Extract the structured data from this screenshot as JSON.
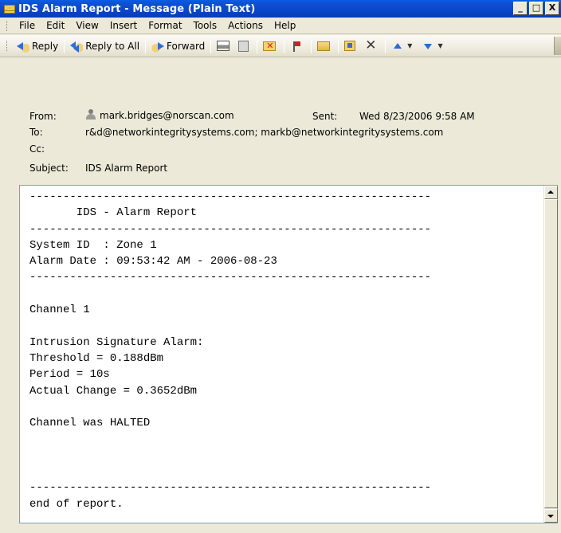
{
  "window": {
    "title": "IDS Alarm Report - Message (Plain Text)",
    "minimize": "_",
    "maximize": "□",
    "close": "X"
  },
  "menu": [
    "File",
    "Edit",
    "View",
    "Insert",
    "Format",
    "Tools",
    "Actions",
    "Help"
  ],
  "toolbar": {
    "reply": "Reply",
    "reply_all": "Reply to All",
    "forward": "Forward",
    "icons": [
      "reply-icon",
      "reply-all-icon",
      "forward-icon",
      "print-icon",
      "copy-icon",
      "move-to-folder-icon",
      "flag-icon",
      "folder-icon",
      "address-book-icon",
      "delete-icon",
      "previous-item-icon",
      "next-item-icon"
    ]
  },
  "header": {
    "from_label": "From:",
    "from_value": "mark.bridges@norscan.com",
    "sent_label": "Sent:",
    "sent_value": "Wed 8/23/2006 9:58 AM",
    "to_label": "To:",
    "to_value": "r&d@networkintegritysystems.com; markb@networkintegritysystems.com",
    "cc_label": "Cc:",
    "cc_value": "",
    "subject_label": "Subject:",
    "subject_value": "IDS Alarm Report"
  },
  "message": {
    "lines": [
      "------------------------------------------------------------",
      "       IDS - Alarm Report",
      "------------------------------------------------------------",
      "System ID  : Zone 1",
      "Alarm Date : 09:53:42 AM - 2006-08-23",
      "------------------------------------------------------------",
      "",
      "Channel 1",
      "",
      "Intrusion Signature Alarm:",
      "Threshold = 0.188dBm",
      "Period = 10s",
      "Actual Change = 0.3652dBm",
      "",
      "Channel was HALTED",
      "",
      "",
      "",
      "------------------------------------------------------------",
      "end of report."
    ]
  },
  "colors": {
    "titlebar": "#0a46c8",
    "window_bg": "#ece9d8",
    "body_bg": "#ffffff",
    "panel_border": "#7f9db9"
  }
}
